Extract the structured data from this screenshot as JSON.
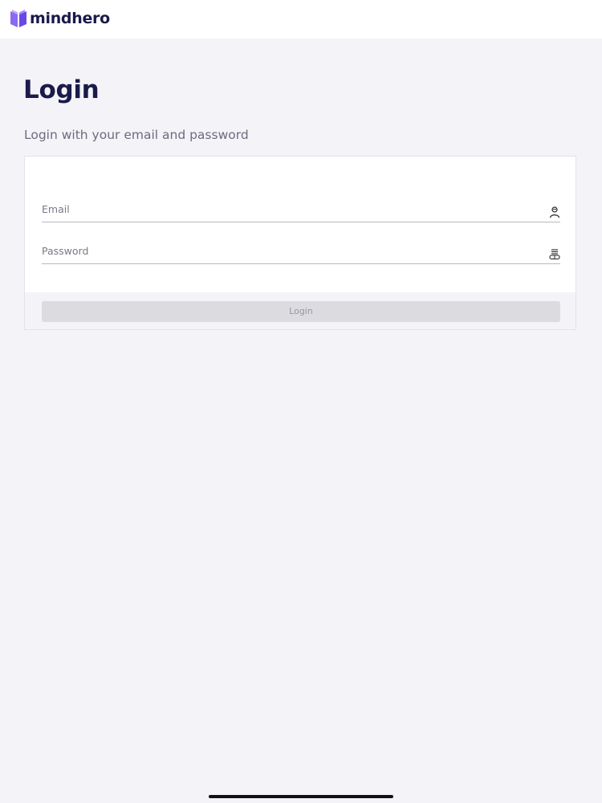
{
  "brand": {
    "name": "mindhero",
    "logo_icon": "book-icon",
    "logo_color": "#7d5cf0"
  },
  "page": {
    "title": "Login",
    "subtitle": "Login with your email and password"
  },
  "form": {
    "email": {
      "placeholder": "Email",
      "value": "",
      "icon": "user-icon"
    },
    "password": {
      "placeholder": "Password",
      "value": "",
      "icon": "keyboard-icon"
    },
    "submit_label": "Login"
  },
  "colors": {
    "title": "#1a1b4a",
    "background": "#f4f3f8",
    "button_disabled": "#dcdbe0"
  }
}
